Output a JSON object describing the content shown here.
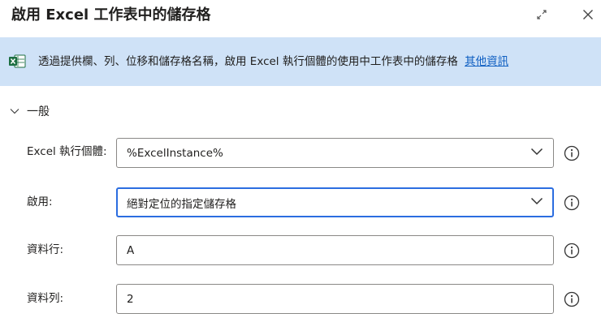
{
  "dialog": {
    "title": "啟用 Excel 工作表中的儲存格",
    "banner": {
      "text": "透過提供欄、列、位移和儲存格名稱，啟用 Excel 執行個體的使用中工作表中的儲存格",
      "link": "其他資訊"
    },
    "section": {
      "label": "一般",
      "expanded": true
    },
    "fields": {
      "excel_instance": {
        "label": "Excel 執行個體:",
        "value": "%ExcelInstance%"
      },
      "activate": {
        "label": "啟用:",
        "value": "絕對定位的指定儲存格"
      },
      "column": {
        "label": "資料行:",
        "value": "A"
      },
      "row": {
        "label": "資料列:",
        "value": "2"
      }
    }
  },
  "icons": {
    "expand": "expand-diagonal-icon",
    "close": "close-icon",
    "excel": "excel-icon",
    "chevron_section": "chevron-down-icon",
    "dropdown_caret": "chevron-down-icon",
    "info": "info-icon"
  },
  "colors": {
    "banner_bg": "#cfe2f7",
    "link": "#0f5fc2",
    "focus_border": "#2b6de0",
    "input_border": "#8a8886",
    "excel_green": "#1d6f42"
  }
}
